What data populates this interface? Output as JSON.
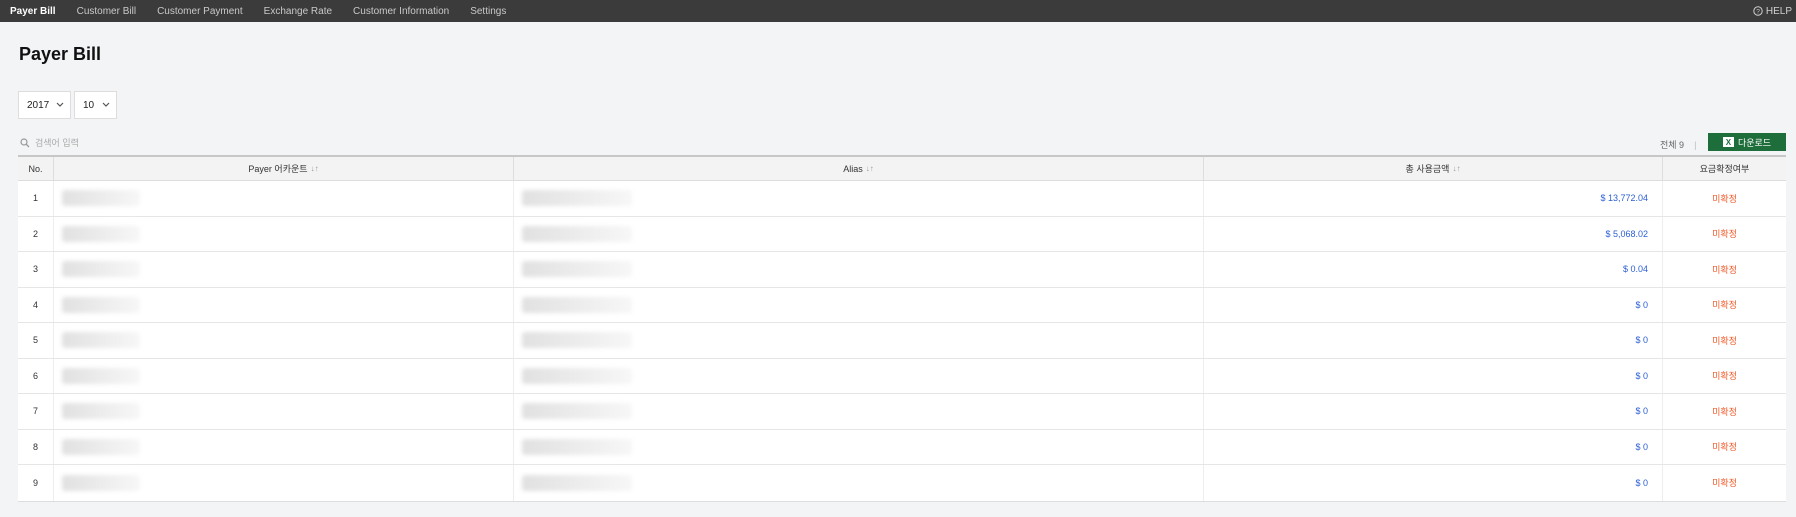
{
  "nav": {
    "items": [
      "Payer Bill",
      "Customer Bill",
      "Customer Payment",
      "Exchange Rate",
      "Customer Information",
      "Settings"
    ],
    "active_index": 0,
    "help_label": "HELP"
  },
  "page": {
    "title": "Payer Bill"
  },
  "filters": {
    "year": "2017",
    "month": "10"
  },
  "search": {
    "placeholder": "검색어 입력"
  },
  "summary": {
    "total_label": "전체 9",
    "separator": "|"
  },
  "download_button": {
    "label": "다운로드",
    "icon_text": "X"
  },
  "table": {
    "headers": {
      "no": "No.",
      "payer": "Payer 어카운트",
      "alias": "Alias",
      "amount": "총 사용금액",
      "status": "요금확정여부",
      "sort_glyph": "↓↑"
    },
    "rows": [
      {
        "no": "1",
        "amount": "$ 13,772.04",
        "status": "미확정"
      },
      {
        "no": "2",
        "amount": "$ 5,068.02",
        "status": "미확정"
      },
      {
        "no": "3",
        "amount": "$ 0.04",
        "status": "미확정"
      },
      {
        "no": "4",
        "amount": "$ 0",
        "status": "미확정"
      },
      {
        "no": "5",
        "amount": "$ 0",
        "status": "미확정"
      },
      {
        "no": "6",
        "amount": "$ 0",
        "status": "미확정"
      },
      {
        "no": "7",
        "amount": "$ 0",
        "status": "미확정"
      },
      {
        "no": "8",
        "amount": "$ 0",
        "status": "미확정"
      },
      {
        "no": "9",
        "amount": "$ 0",
        "status": "미확정"
      }
    ]
  },
  "colors": {
    "topbar": "#3b3b3b",
    "amount": "#2b5fd4",
    "status": "#f05a28",
    "download": "#1e6e3c"
  }
}
